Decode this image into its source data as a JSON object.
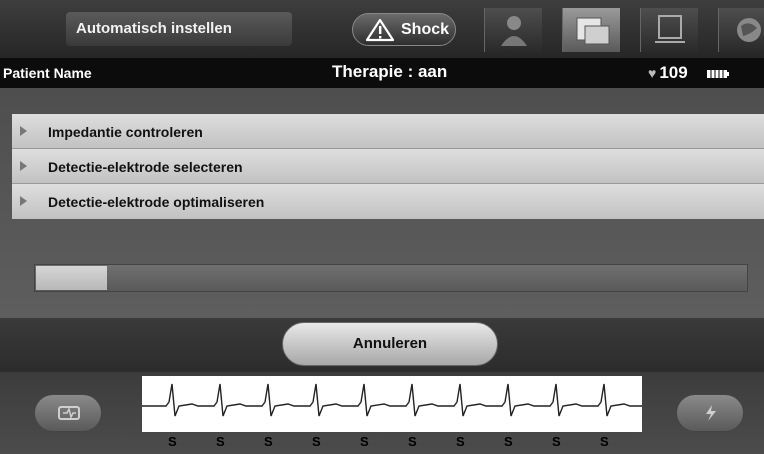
{
  "header": {
    "title": "Automatisch instellen",
    "shock_label": "Shock",
    "tabs": [
      {
        "icon": "patient-portrait-icon"
      },
      {
        "icon": "device-stack-icon",
        "active": true
      },
      {
        "icon": "laptop-icon"
      },
      {
        "icon": "globe-icon"
      }
    ]
  },
  "patient_bar": {
    "patient_name": "Patient Name",
    "therapy": "Therapie : aan",
    "heart_rate": "109",
    "icons": [
      "heart-icon",
      "battery-icon",
      "wireless-signal-icon"
    ]
  },
  "steps": [
    {
      "label": "Impedantie controleren"
    },
    {
      "label": "Detectie-elektrode selecteren"
    },
    {
      "label": "Detectie-elektrode optimaliseren"
    }
  ],
  "progress": {
    "fraction": 0.1
  },
  "actions": {
    "cancel_label": "Annuleren"
  },
  "ecg": {
    "beat_labels": [
      "S",
      "S",
      "S",
      "S",
      "S",
      "S",
      "S",
      "S",
      "S",
      "S"
    ],
    "left_button_icon": "record-icon",
    "right_button_icon": "shock-bolt-icon"
  }
}
